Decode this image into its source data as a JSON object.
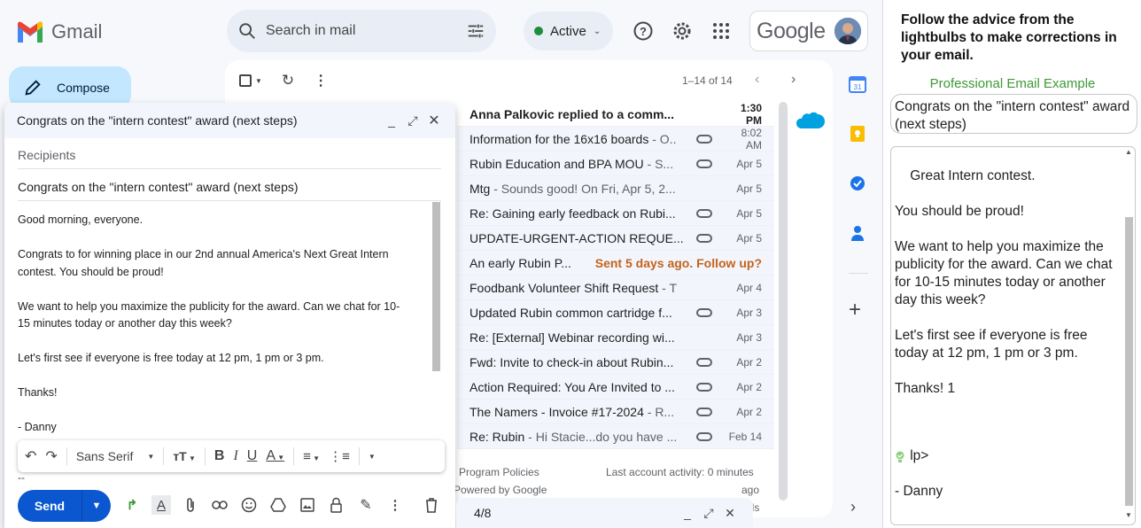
{
  "app": {
    "name": "Gmail"
  },
  "search": {
    "placeholder": "Search in mail"
  },
  "status": {
    "label": "Active",
    "color": "#1e8e3e"
  },
  "account": {
    "brand": "Google"
  },
  "compose_button": {
    "label": "Compose"
  },
  "list": {
    "pager": "1–14 of 14",
    "rows": [
      {
        "subject": "Anna Palkovic replied to a comm...",
        "snippet": "",
        "date": "1:30 PM",
        "unread": true,
        "attachment": false
      },
      {
        "subject": "Information for the 16x16 boards",
        "snippet": " - O..",
        "date": "8:02 AM",
        "unread": false,
        "attachment": true
      },
      {
        "subject": "Rubin Education and BPA MOU",
        "snippet": " - S...",
        "date": "Apr 5",
        "unread": false,
        "attachment": true
      },
      {
        "subject": "Mtg",
        "snippet": " - Sounds good! On Fri, Apr 5, 2...",
        "date": "Apr 5",
        "unread": false,
        "attachment": false
      },
      {
        "subject": "Re: Gaining early feedback on Rubi...",
        "snippet": "",
        "date": "Apr 5",
        "unread": false,
        "attachment": true
      },
      {
        "subject": "UPDATE-URGENT-ACTION REQUE...",
        "snippet": "",
        "date": "Apr 5",
        "unread": false,
        "attachment": true
      },
      {
        "subject": "An early Rubin P...",
        "snippet": "",
        "date": "",
        "unread": false,
        "attachment": false,
        "followup": "Sent 5 days ago. Follow up?"
      },
      {
        "subject": "Foodbank Volunteer Shift Request",
        "snippet": " - T",
        "date": "Apr 4",
        "unread": false,
        "attachment": false
      },
      {
        "subject": "Updated Rubin common cartridge f...",
        "snippet": "",
        "date": "Apr 3",
        "unread": false,
        "attachment": true
      },
      {
        "subject": "Re: [External] Webinar recording wi...",
        "snippet": "",
        "date": "Apr 3",
        "unread": false,
        "attachment": false
      },
      {
        "subject": "Fwd: Invite to check-in about Rubin...",
        "snippet": "",
        "date": "Apr 2",
        "unread": false,
        "attachment": true
      },
      {
        "subject": "Action Required: You Are Invited to ...",
        "snippet": "",
        "date": "Apr 2",
        "unread": false,
        "attachment": true
      },
      {
        "subject": "The Namers - Invoice #17-2024",
        "snippet": " - R...",
        "date": "Apr 2",
        "unread": false,
        "attachment": true
      },
      {
        "subject": "Re: Rubin",
        "snippet": " - Hi Stacie...do you have ...",
        "date": "Feb 14",
        "unread": false,
        "attachment": true
      }
    ],
    "footer": {
      "policies": "Program Policies",
      "powered": "Powered by Google",
      "activity": "Last account activity: 0 minutes",
      "ago": "ago",
      "details": "ils"
    }
  },
  "compose": {
    "title": "Congrats on the \"intern contest\" award (next steps)",
    "recipients_placeholder": "Recipients",
    "subject": "Congrats on the \"intern contest\" award (next steps)",
    "body": "Good morning, everyone.\n\nCongrats to for winning place in our 2nd annual America's Next Great Intern\ncontest. You should be proud!\n\nWe want to help you maximize the publicity for the award. Can we chat for 10-\n15 minutes today or another day this week?\n\nLet's first see if everyone is free today at 12 pm, 1 pm or 3 pm.\n\nThanks!\n\n- Danny",
    "font": "Sans Serif",
    "signature_dash": "--",
    "send": "Send"
  },
  "mini_compose": {
    "label": "4/8"
  },
  "assistant": {
    "title": "Follow the advice from the lightbulbs to make corrections in your email.",
    "example_label": "Professional Email Example",
    "subject": "Congrats on the \"intern contest\" award (next steps)",
    "body_part1": "Great Intern contest.\n\nYou should be proud!\n\nWe want to help you maximize the publicity for the award. Can we chat for 10-15 minutes today or another day this week?\n\nLet's first see if everyone is free today at 12 pm, 1 pm or 3 pm.\n\nThanks! 1",
    "body_part2": "lp>\n\n- Danny"
  },
  "colors": {
    "compose_btn": "#c2e7ff",
    "send": "#0b57d0",
    "followup": "#c5621a",
    "example": "#3d9a35"
  }
}
